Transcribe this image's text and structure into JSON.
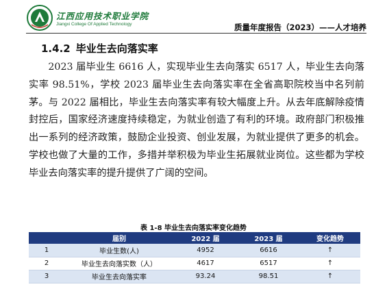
{
  "header": {
    "logo_cn": "江西应用技术职业学院",
    "logo_en": "Jiangxi College Of Applied Technology",
    "report_title": "质量年度报告（2023）——人才培养"
  },
  "section": {
    "number": "1.4.2",
    "title": "毕业生去向落实率"
  },
  "paragraph": "2023 届毕业生 6616 人，实现毕业生去向落实 6517 人，毕业生去向落实率 98.51%，学校 2023 届毕业生去向落实率在全省高职院校当中名列前茅。与 2022 届相比，毕业生去向落实率有较大幅度上升。从去年底解除疫情封控后，国家经济速度持续稳定，为就业创造了有利的环境。政府部门积极推出一系列的经济政策，鼓励企业投资、创业发展，为就业提供了更多的机会。学校也做了大量的工作，多措并举积极为毕业生拓展就业岗位。这些都为学校毕业去向落实率的提升提供了广阔的空间。",
  "table": {
    "caption": "表 1-8  毕业生去向落实率变化趋势",
    "headers": [
      "",
      "届别",
      "2022 届",
      "2023 届",
      "变化趋势"
    ],
    "rows": [
      [
        "1",
        "毕业生数(人)",
        "4952",
        "6616",
        "↑"
      ],
      [
        "2",
        "毕业生去向落实数（人）",
        "4617",
        "6517",
        "↑"
      ],
      [
        "3",
        "毕业生去向落实率",
        "93.24",
        "98.51",
        "↑"
      ]
    ]
  },
  "colors": {
    "header_fill": "#1f3b80",
    "row_shade": "#dbe5f3",
    "logo_green": "#1e7a3a"
  }
}
